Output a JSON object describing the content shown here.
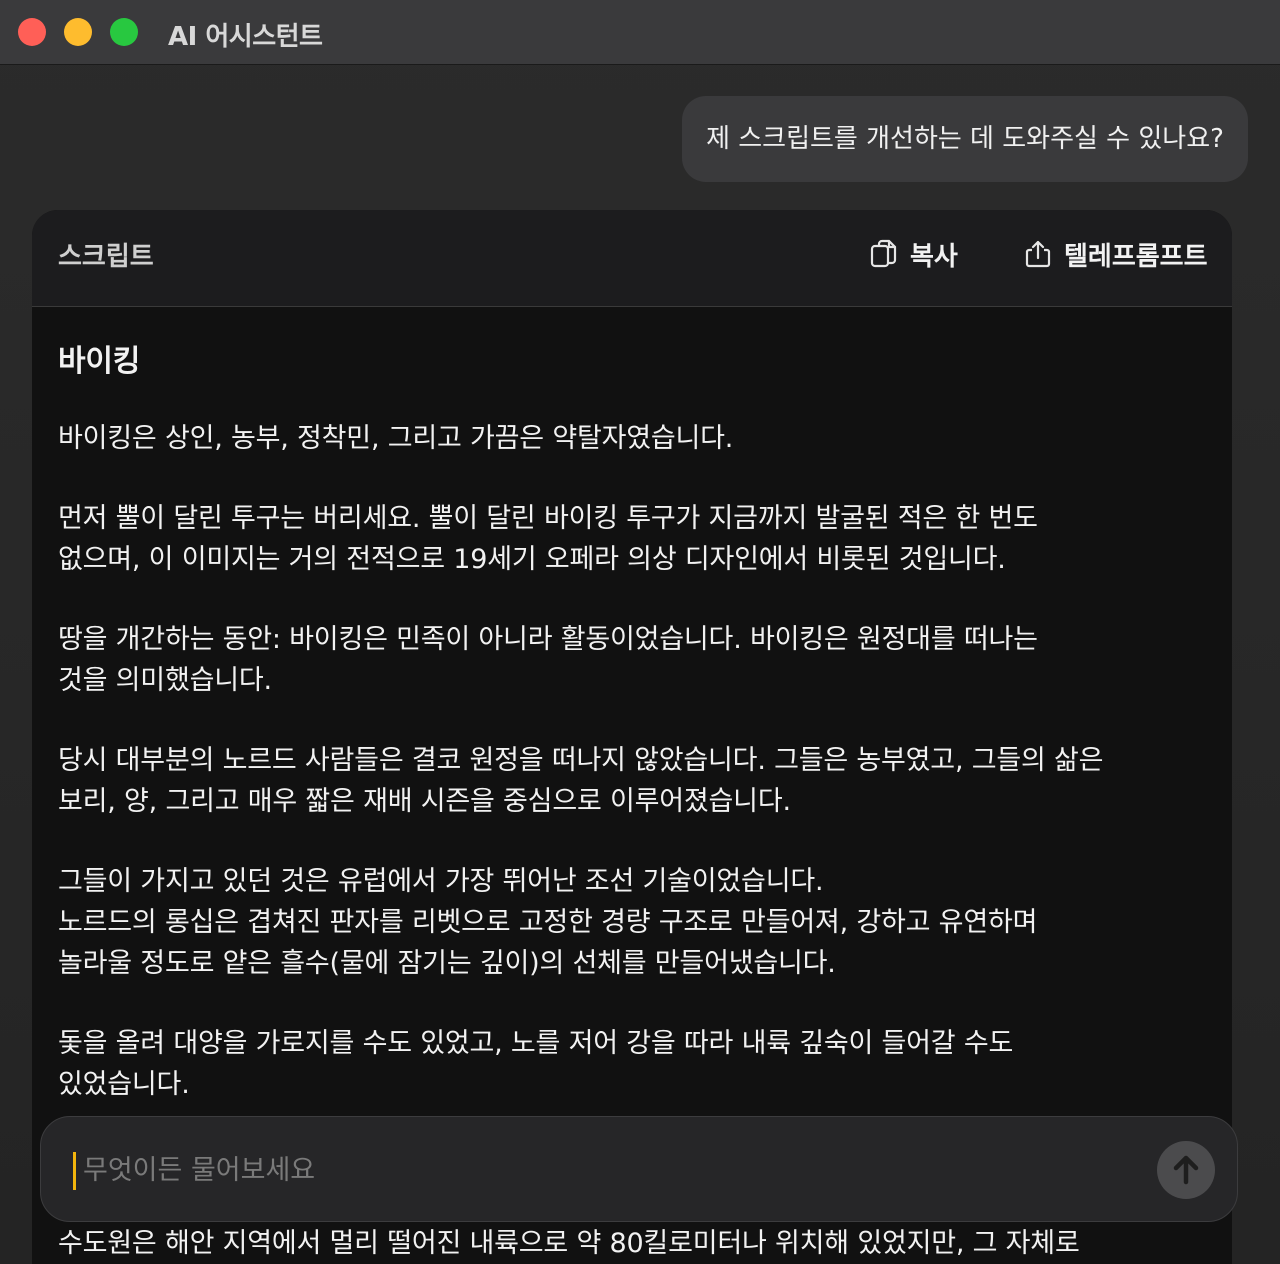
{
  "window": {
    "title": "AI 어시스턴트"
  },
  "chat": {
    "user_message": "제 스크립트를 개선하는 데 도와주실 수 있나요?"
  },
  "script_card": {
    "title": "스크립트",
    "copy_label": "복사",
    "teleprompter_label": "텔레프롬프트",
    "heading": "바이킹",
    "paragraphs": [
      "바이킹은 상인, 농부, 정착민, 그리고 가끔은 약탈자였습니다.",
      "먼저 뿔이 달린 투구는 버리세요. 뿔이 달린 바이킹 투구가 지금까지 발굴된 적은 한 번도\n없으며, 이 이미지는 거의 전적으로 19세기 오페라 의상 디자인에서 비롯된 것입니다.",
      "땅을 개간하는 동안: 바이킹은 민족이 아니라 활동이었습니다. 바이킹은 원정대를 떠나는\n것을 의미했습니다.",
      "당시 대부분의 노르드 사람들은 결코 원정을 떠나지 않았습니다. 그들은 농부였고, 그들의 삶은\n보리, 양, 그리고 매우 짧은 재배 시즌을 중심으로 이루어졌습니다.",
      "그들이 가지고 있던 것은 유럽에서 가장 뛰어난 조선 기술이었습니다.\n노르드의 롱십은 겹쳐진 판자를 리벳으로 고정한 경량 구조로 만들어져, 강하고 유연하며\n놀라울 정도로 얕은 흘수(물에 잠기는 깊이)의 선체를 만들어냈습니다.",
      "돛을 올려 대양을 가로지를 수도 있었고, 노를 저어 강을 따라 내륙 깊숙이 들어갈 수도\n있었습니다."
    ],
    "trailing_line": "수도원은 해안 지역에서 멀리 떨어진 내륙으로 약 80킬로미터나 위치해 있었지만, 그 자체로"
  },
  "input": {
    "placeholder": "무엇이든 물어보세요",
    "value": ""
  },
  "icons": {
    "copy": "copy-icon",
    "share": "share-icon",
    "send": "arrow-up-icon"
  }
}
